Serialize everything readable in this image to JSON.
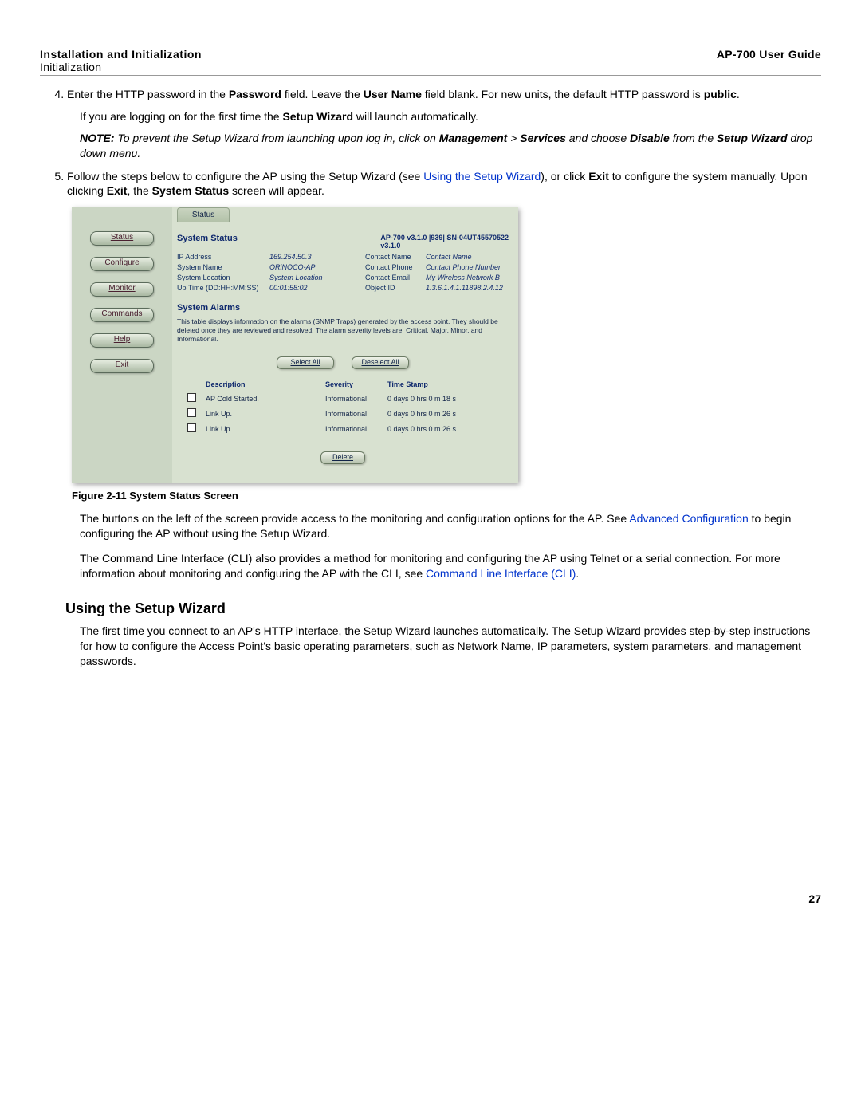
{
  "header": {
    "chapter": "Installation and Initialization",
    "subsection": "Initialization",
    "guide": "AP-700 User Guide"
  },
  "steps": {
    "s4_a": "Enter the HTTP password in the ",
    "s4_b": "Password",
    "s4_c": " field. Leave the ",
    "s4_d": "User Name",
    "s4_e": " field blank. For new units, the default HTTP password is ",
    "s4_f": "public",
    "s4_g": ".",
    "s4_sub_a": "If you are logging on for the first time the ",
    "s4_sub_b": "Setup Wizard",
    "s4_sub_c": " will launch automatically.",
    "note_lead": "NOTE:",
    "note_a": " To prevent the Setup Wizard from launching upon log in, click on ",
    "note_mgmt": "Management",
    "note_gt": " > ",
    "note_services": "Services",
    "note_b": " and choose ",
    "note_disable": "Disable",
    "note_c": " from the ",
    "note_swiz": "Setup Wizard",
    "note_d": " drop down menu.",
    "s5_a": "Follow the steps below to configure the AP using the Setup Wizard (see ",
    "s5_link": "Using the Setup Wizard",
    "s5_b": "), or click ",
    "s5_exit": "Exit",
    "s5_c": " to configure the system manually. Upon clicking ",
    "s5_exit2": "Exit",
    "s5_d": ", the ",
    "s5_syst": "System Status",
    "s5_e": " screen will appear."
  },
  "shot": {
    "nav": [
      "Status",
      "Configure",
      "Monitor",
      "Commands",
      "Help",
      "Exit"
    ],
    "tab": "Status",
    "title1": "System Status",
    "top_right": "AP-700  v3.1.0  |939|  SN-04UT45570522",
    "ver": "v3.1.0",
    "leftlabels": [
      "IP Address",
      "System Name",
      "System Location",
      "Up Time (DD:HH:MM:SS)"
    ],
    "leftvals": [
      "169.254.50.3",
      "ORiNOCO-AP",
      "System Location",
      "00:01:58:02"
    ],
    "rightlabels": [
      "Contact Name",
      "Contact Phone",
      "Contact Email",
      "Object ID"
    ],
    "rightvals": [
      "Contact Name",
      "Contact Phone Number",
      "My Wireless Network B",
      "1.3.6.1.4.1.11898.2.4.12"
    ],
    "alarms_title": "System Alarms",
    "alarms_desc": "This table displays information on the alarms (SNMP Traps) generated by the access point. They should be deleted once they are reviewed and resolved. The alarm severity levels are: Critical, Major, Minor, and Informational.",
    "btn_selectall": "Select All",
    "btn_deselectall": "Deselect All",
    "btn_delete": "Delete",
    "cols": [
      "Description",
      "Severity",
      "Time Stamp"
    ],
    "rows": [
      {
        "desc": "AP Cold Started.",
        "sev": "Informational",
        "ts": "0 days 0 hrs 0 m 18 s"
      },
      {
        "desc": "Link Up.",
        "sev": "Informational",
        "ts": "0 days 0 hrs 0 m 26 s"
      },
      {
        "desc": "Link Up.",
        "sev": "Informational",
        "ts": "0 days 0 hrs 0 m 26 s"
      }
    ]
  },
  "fig_caption": "Figure 2-11  System Status Screen",
  "after": {
    "p1_a": "The buttons on the left of the screen provide access to the monitoring and configuration options for the AP. See ",
    "p1_link": "Advanced Configuration",
    "p1_b": " to begin configuring the AP without using the Setup Wizard.",
    "p2_a": "The Command Line Interface (CLI) also provides a method for monitoring and configuring the AP using Telnet or a serial connection. For more information about monitoring and configuring the AP with the CLI, see ",
    "p2_link": "Command Line Interface (CLI)",
    "p2_b": "."
  },
  "section_title": "Using the Setup Wizard",
  "section_para": "The first time you connect to an AP's HTTP interface, the Setup Wizard launches automatically. The Setup Wizard provides step-by-step instructions for how to configure the Access Point's basic operating parameters, such as Network Name, IP parameters, system parameters, and management passwords.",
  "page_number": "27"
}
